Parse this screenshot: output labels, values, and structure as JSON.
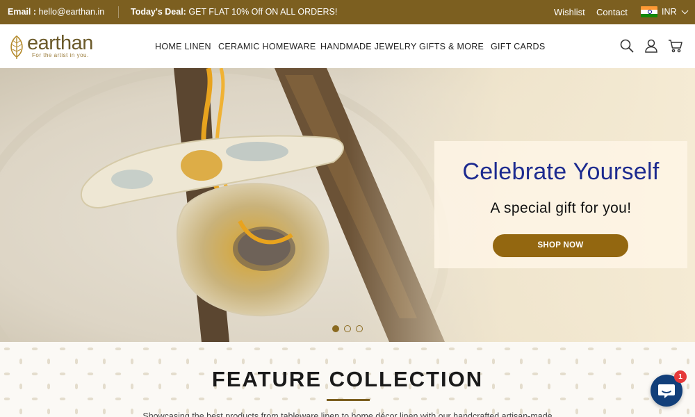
{
  "topbar": {
    "email_label": "Email :",
    "email_value": "hello@earthan.in",
    "deal_label": "Today's Deal:",
    "deal_text": "GET FLAT 10% Off ON ALL ORDERS!",
    "wishlist": "Wishlist",
    "contact": "Contact",
    "currency": "INR",
    "flag_icon": "india-flag-icon"
  },
  "header": {
    "logo_text": "earthan",
    "logo_tagline": "For the artist in you.",
    "nav": [
      "HOME LINEN",
      "CERAMIC HOMEWARE",
      "HANDMADE JEWELRY",
      "GIFTS & MORE",
      "GIFT CARDS"
    ],
    "icons": [
      "search-icon",
      "account-icon",
      "cart-icon"
    ]
  },
  "hero": {
    "title": "Celebrate Yourself",
    "subtitle": "A special gift for you!",
    "cta": "SHOP NOW",
    "slides_total": 3,
    "active_slide": 1
  },
  "feature": {
    "title": "FEATURE COLLECTION",
    "description": "Showcasing the best products from tableware linen to home décor linen with our handcrafted artisan-made"
  },
  "chat": {
    "badge_count": "1",
    "icon": "chat-icon"
  },
  "colors": {
    "brand_brown": "#7c5f20",
    "cta_gold": "#936710",
    "headline_blue": "#1c2a8f",
    "chat_blue": "#123f7a",
    "badge_red": "#e5393a"
  }
}
